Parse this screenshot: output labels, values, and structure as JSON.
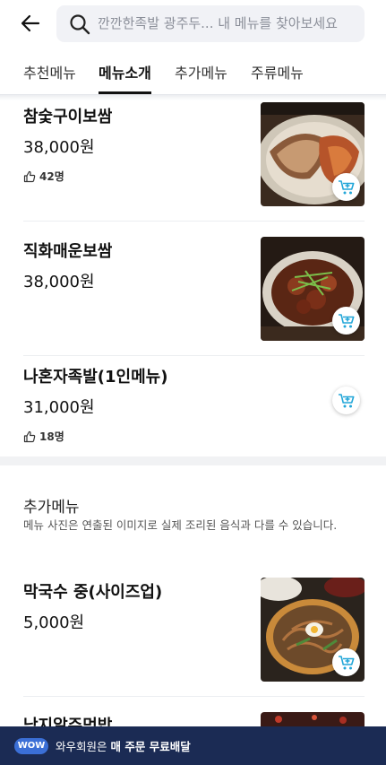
{
  "search": {
    "placeholder": "깐깐한족발 광주두... 내 메뉴를 찾아보세요"
  },
  "tabs": [
    {
      "label": "추천메뉴",
      "active": false
    },
    {
      "label": "메뉴소개",
      "active": true
    },
    {
      "label": "추가메뉴",
      "active": false
    },
    {
      "label": "주류메뉴",
      "active": false
    }
  ],
  "menu_items": [
    {
      "name": "참숯구이보쌈",
      "price": "38,000원",
      "likes": "42명"
    },
    {
      "name": "직화매운보쌈",
      "price": "38,000원"
    },
    {
      "name": "나혼자족발(1인메뉴)",
      "price": "31,000원",
      "likes": "18명"
    }
  ],
  "extra_section": {
    "title": "추가메뉴",
    "description": "메뉴 사진은 연출된 이미지로 실제 조리된 음식과 다를 수 있습니다.",
    "items": [
      {
        "name": "막국수 중(사이즈업)",
        "price": "5,000원"
      },
      {
        "name": "낙지알주먹밥"
      }
    ]
  },
  "banner": {
    "badge": "WOW",
    "text_prefix": "와우회원은 ",
    "text_bold": "매 주문 무료배달"
  },
  "colors": {
    "banner_bg": "#1b2b54",
    "badge_bg": "#3b6fd6",
    "cart_icon": "#22a6d8"
  }
}
